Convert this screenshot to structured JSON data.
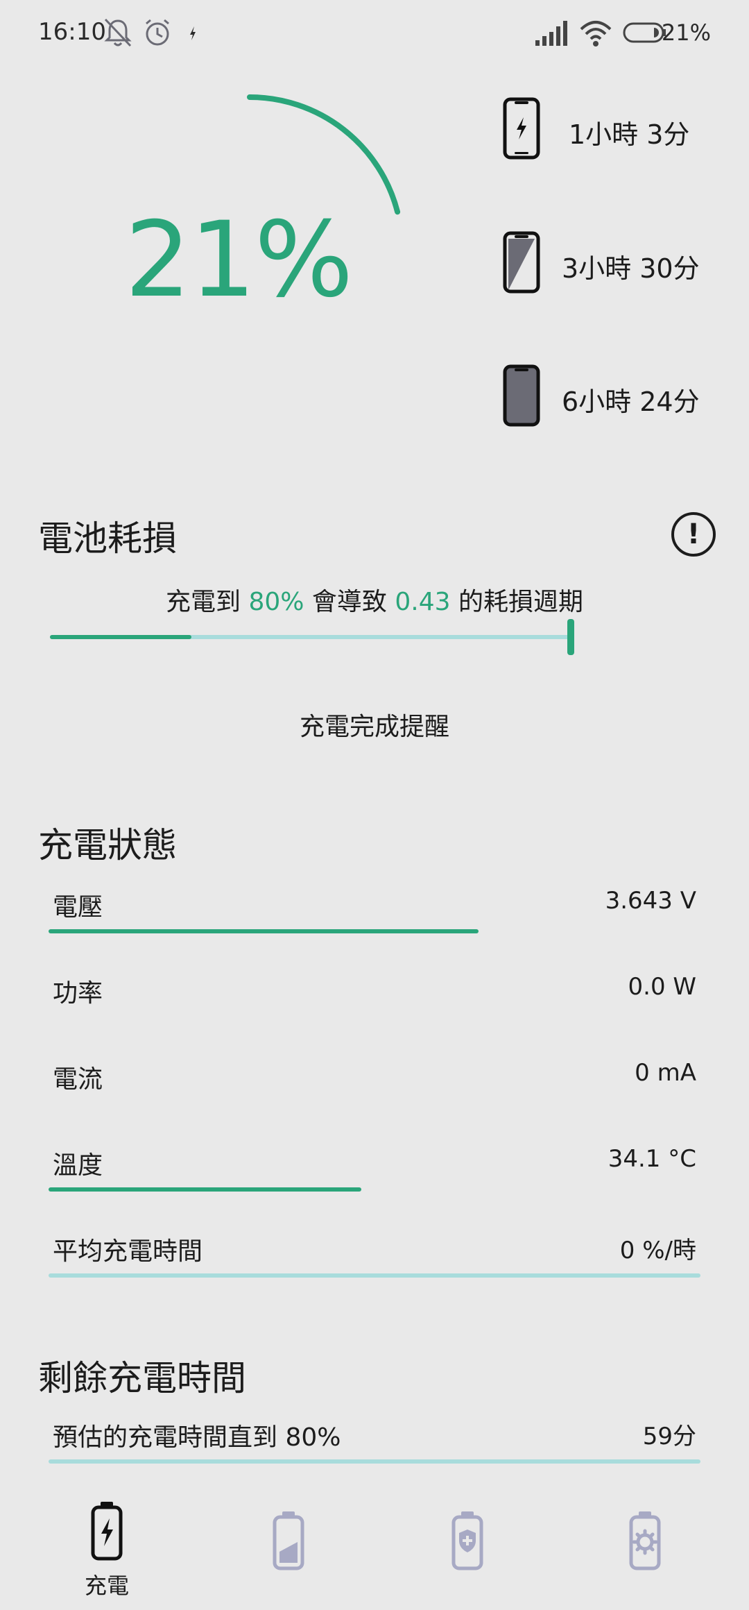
{
  "status_bar": {
    "time": "16:10",
    "battery_text": "21%"
  },
  "battery": {
    "percent_text": "21%",
    "percent_value": 21
  },
  "estimates": [
    {
      "icon": "phone-charging-icon",
      "text": "1小時 3分"
    },
    {
      "icon": "phone-half-screen-icon",
      "text": "3小時 30分"
    },
    {
      "icon": "phone-screen-off-icon",
      "text": "6小時 24分"
    }
  ],
  "wear": {
    "title": "電池耗損",
    "line_prefix": "充電到 ",
    "target_percent": "80%",
    "line_middle": " 會導致 ",
    "cycles": "0.43",
    "line_suffix": " 的耗損週期",
    "slider_level": 0.27,
    "reminder_label": "充電完成提醒"
  },
  "charging_status": {
    "title": "充電狀態",
    "rows": [
      {
        "label": "電壓",
        "value": "3.643 V",
        "bar": 0.66
      },
      {
        "label": "功率",
        "value": "0.0 W"
      },
      {
        "label": "電流",
        "value": "0 mA"
      },
      {
        "label": "溫度",
        "value": "34.1 °C",
        "bar": 0.48
      },
      {
        "label": "平均充電時間",
        "value": "0 %/時",
        "bar": 0
      }
    ]
  },
  "remaining": {
    "title": "剩餘充電時間",
    "label": "預估的充電時間直到 80%",
    "value": "59分"
  },
  "nav": {
    "charging_label": "充電"
  },
  "colors": {
    "accent": "#2aa57a",
    "track": "#a8dcdc",
    "background": "#e9e9e9",
    "inactive_icon": "#a7a9c4"
  }
}
